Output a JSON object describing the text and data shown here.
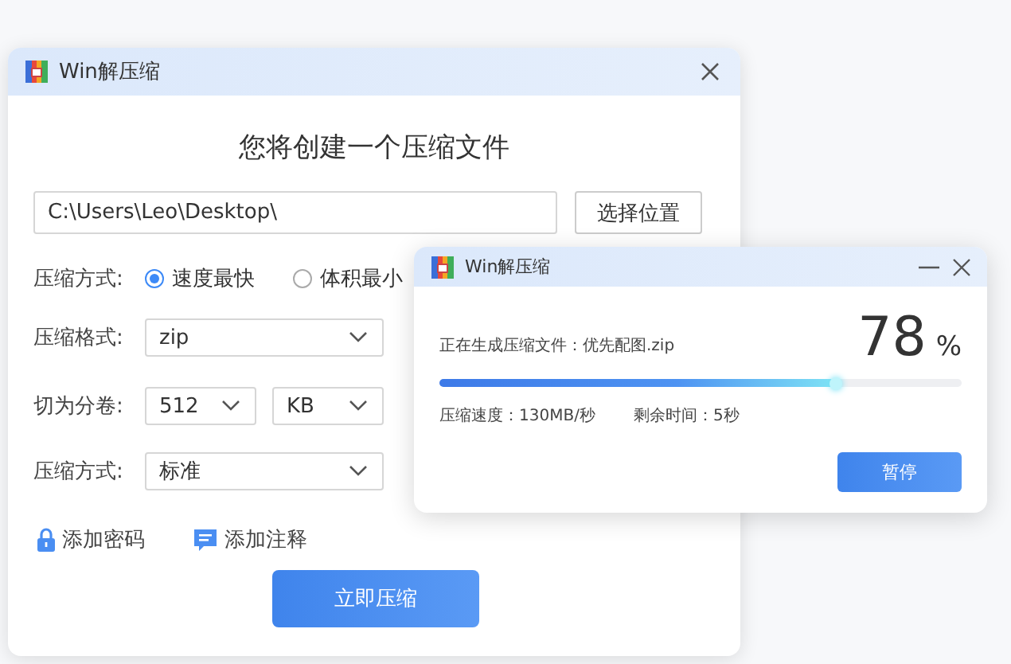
{
  "main_window": {
    "title": "Win解压缩",
    "heading": "您将创建一个压缩文件",
    "path_field": {
      "value": "C:\\Users\\Leo\\Desktop\\"
    },
    "choose_button": "选择位置",
    "mode": {
      "label": "压缩方式:",
      "options": [
        {
          "label": "速度最快",
          "selected": true
        },
        {
          "label": "体积最小",
          "selected": false
        }
      ]
    },
    "format": {
      "label": "压缩格式:",
      "value": "zip"
    },
    "split": {
      "label": "切为分卷:",
      "size": "512",
      "unit": "KB"
    },
    "method": {
      "label": "压缩方式:",
      "value": "标准"
    },
    "links": [
      {
        "kind": "lock",
        "label": "添加密码"
      },
      {
        "kind": "comment",
        "label": "添加注释"
      }
    ],
    "compress_button": "立即压缩"
  },
  "progress_dialog": {
    "title": "Win解压缩",
    "status": "正在生成压缩文件：优先配图.zip",
    "percent": "78",
    "percent_sign": "%",
    "level": 0.76,
    "speed": "压缩速度：130MB/秒",
    "remaining": "剩余时间：5秒",
    "pause_button": "暂停"
  }
}
